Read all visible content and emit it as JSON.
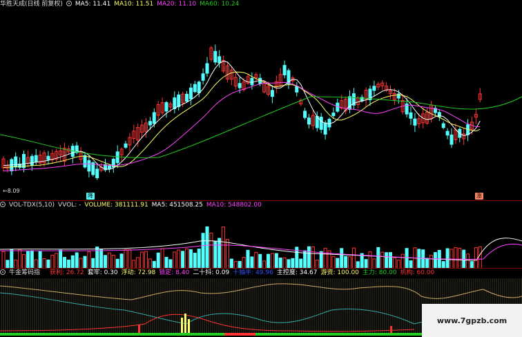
{
  "main": {
    "title": "华胜天成(日线 前复权)",
    "ma": [
      {
        "label": "MA5: 11.41",
        "color": "#ffffff"
      },
      {
        "label": "MA10: 11.51",
        "color": "#ffff66"
      },
      {
        "label": "MA20: 11.10",
        "color": "#ff44ff"
      },
      {
        "label": "MA60: 10.24",
        "color": "#22cc22"
      }
    ],
    "low_label": "8.09",
    "badge_down": "降",
    "badge_up": "涨"
  },
  "volume": {
    "title": "VOL-TDX(5,10)",
    "vvol": "VVOL: -",
    "values": [
      {
        "label": "VOLUME: 381111.91",
        "color": "#ffff66"
      },
      {
        "label": "MA5: 451508.25",
        "color": "#ffffff"
      },
      {
        "label": "MA10: 548802.00",
        "color": "#ff44ff"
      }
    ]
  },
  "indicator": {
    "title": "牛金筹码指",
    "values": [
      {
        "label": "获利: 26.72",
        "color": "#ff3333"
      },
      {
        "label": "套牢: 0.30",
        "color": "#ffffff"
      },
      {
        "label": "浮动: 72.98",
        "color": "#ffff66"
      },
      {
        "label": "锁定: 8.40",
        "color": "#ff44ff"
      },
      {
        "label": "二十抖: 0.09",
        "color": "#ffffff"
      },
      {
        "label": "十抽半: 49.96",
        "color": "#3355ff"
      },
      {
        "label": "主控度: 34.67",
        "color": "#ffffff"
      },
      {
        "label": "游资: 100.00",
        "color": "#ffff66"
      },
      {
        "label": "主力: 80.00",
        "color": "#22cc22"
      },
      {
        "label": "机构: 60.00",
        "color": "#ff3333"
      }
    ]
  },
  "watermark": "www.7gpzb.com",
  "colors": {
    "up": "#ff3333",
    "down": "#54ffff",
    "bg": "#000000",
    "grid": "#7a0000"
  },
  "icons": {
    "settings": "gear-icon"
  }
}
